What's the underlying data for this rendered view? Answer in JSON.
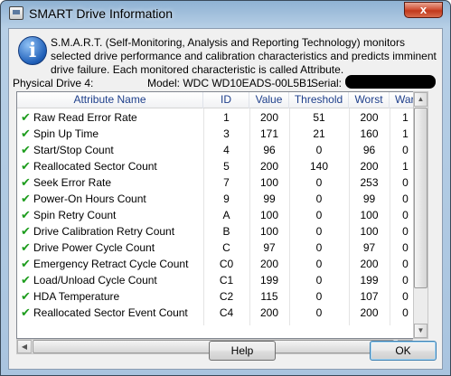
{
  "window": {
    "title": "SMART Drive Information",
    "close_glyph": "x"
  },
  "info": {
    "icon_letter": "i",
    "text": "S.M.A.R.T. (Self-Monitoring, Analysis and Reporting Technology) monitors selected drive performance and calibration characteristics and predicts imminent drive failure. Each monitored characteristic is called Attribute."
  },
  "drive": {
    "physical": "Physical Drive 4:",
    "model": "Model: WDC WD10EADS-00L5B1",
    "serial_label": "Serial:"
  },
  "table": {
    "headers": [
      "Attribute Name",
      "ID",
      "Value",
      "Threshold",
      "Worst",
      "Warranty"
    ],
    "rows": [
      {
        "name": "Raw Read Error Rate",
        "id": "1",
        "value": "200",
        "threshold": "51",
        "worst": "200",
        "warranty": "1"
      },
      {
        "name": "Spin Up Time",
        "id": "3",
        "value": "171",
        "threshold": "21",
        "worst": "160",
        "warranty": "1"
      },
      {
        "name": "Start/Stop Count",
        "id": "4",
        "value": "96",
        "threshold": "0",
        "worst": "96",
        "warranty": "0"
      },
      {
        "name": "Reallocated Sector Count",
        "id": "5",
        "value": "200",
        "threshold": "140",
        "worst": "200",
        "warranty": "1"
      },
      {
        "name": "Seek Error Rate",
        "id": "7",
        "value": "100",
        "threshold": "0",
        "worst": "253",
        "warranty": "0"
      },
      {
        "name": "Power-On Hours Count",
        "id": "9",
        "value": "99",
        "threshold": "0",
        "worst": "99",
        "warranty": "0"
      },
      {
        "name": "Spin Retry Count",
        "id": "A",
        "value": "100",
        "threshold": "0",
        "worst": "100",
        "warranty": "0"
      },
      {
        "name": "Drive Calibration Retry Count",
        "id": "B",
        "value": "100",
        "threshold": "0",
        "worst": "100",
        "warranty": "0"
      },
      {
        "name": "Drive Power Cycle Count",
        "id": "C",
        "value": "97",
        "threshold": "0",
        "worst": "97",
        "warranty": "0"
      },
      {
        "name": "Emergency Retract Cycle Count",
        "id": "C0",
        "value": "200",
        "threshold": "0",
        "worst": "200",
        "warranty": "0"
      },
      {
        "name": "Load/Unload Cycle Count",
        "id": "C1",
        "value": "199",
        "threshold": "0",
        "worst": "199",
        "warranty": "0"
      },
      {
        "name": "HDA Temperature",
        "id": "C2",
        "value": "115",
        "threshold": "0",
        "worst": "107",
        "warranty": "0"
      },
      {
        "name": "Reallocated Sector Event Count",
        "id": "C4",
        "value": "200",
        "threshold": "0",
        "worst": "200",
        "warranty": "0"
      }
    ]
  },
  "status_icon": "green-check-icon",
  "buttons": {
    "help": "Help",
    "ok": "OK"
  },
  "colors": {
    "header_text": "#1e3f8b",
    "check": "#1d9c1d",
    "titlebar": "#a9c4df",
    "close": "#c0391c"
  }
}
